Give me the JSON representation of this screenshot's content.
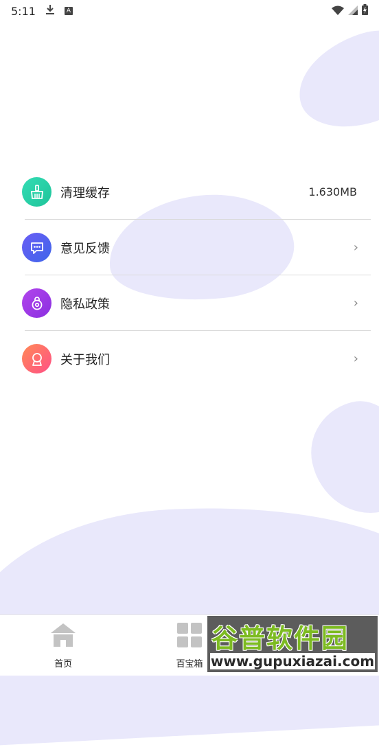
{
  "status_bar": {
    "time": "5:11",
    "icons": [
      "download-icon",
      "a-badge-icon",
      "wifi-icon",
      "signal-icon",
      "battery-icon"
    ]
  },
  "menu": {
    "items": [
      {
        "label": "清理缓存",
        "value": "1.630MB",
        "icon": "broom-icon",
        "color": "#26d0a8"
      },
      {
        "label": "意见反馈",
        "icon": "chat-bubble-icon",
        "color": "#5b5bf0"
      },
      {
        "label": "隐私政策",
        "icon": "lock-icon",
        "color": "#a03be8"
      },
      {
        "label": "关于我们",
        "icon": "badge-icon",
        "color": "#ff6f73"
      }
    ]
  },
  "tab_bar": {
    "tabs": [
      {
        "label": "首页",
        "icon": "home-icon"
      },
      {
        "label": "百宝箱",
        "icon": "grid-icon"
      }
    ]
  },
  "watermark": {
    "title": "谷普软件园",
    "url": "www.gupuxiazai.com"
  },
  "colors": {
    "background_blob": "#e9e8fb",
    "divider": "#dadada",
    "tab_icon": "#c3c3c3"
  }
}
